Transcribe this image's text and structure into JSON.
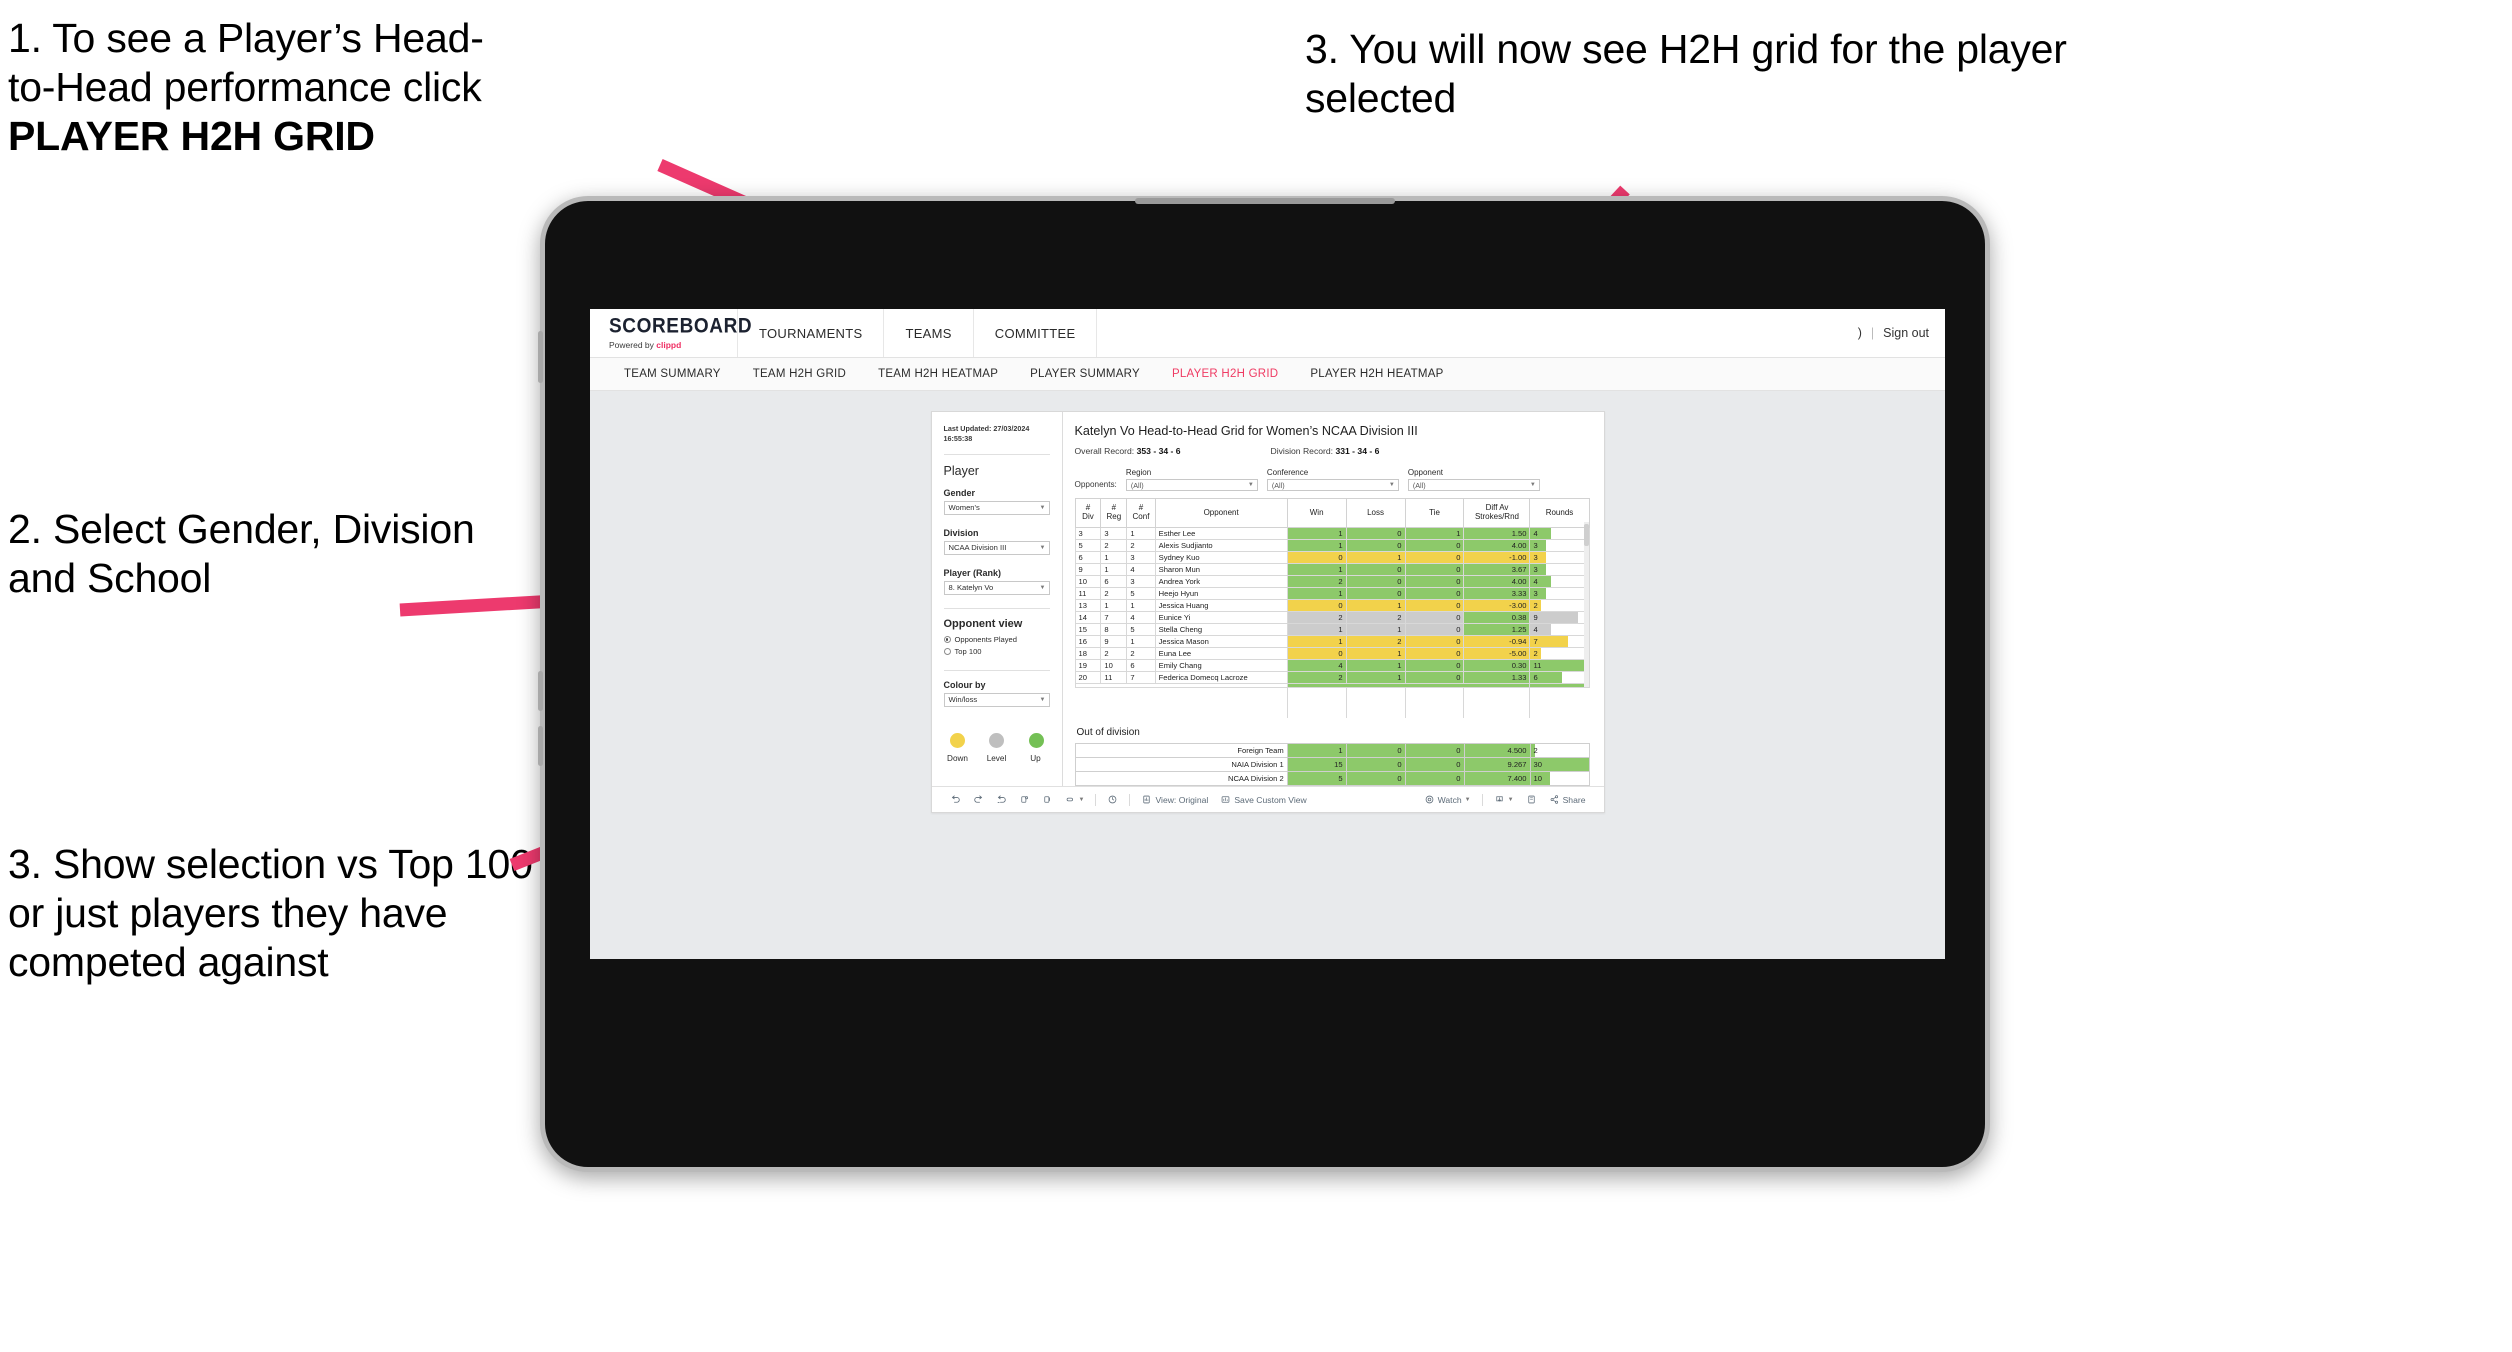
{
  "annotations": {
    "a1_line1": "1. To see a Player’s Head-",
    "a1_line2": "to-Head performance click",
    "a1_bold": "PLAYER H2H GRID",
    "a2": "2. Select Gender, Division and School",
    "a3": "3. Show selection vs Top 100 or just players they have competed against",
    "a4": "3. You will now see H2H grid for the player selected",
    "arrow_color": "#ed3a6e"
  },
  "app": {
    "logo_word": "SCOREBOARD",
    "logo_sub_pre": "Powered by ",
    "logo_sub_brand": "clippd",
    "top_nav": [
      "TOURNAMENTS",
      "TEAMS",
      "COMMITTEE"
    ],
    "account_glyph": ")",
    "sign_out": "Sign out",
    "sub_nav": [
      {
        "label": "TEAM SUMMARY",
        "active": false
      },
      {
        "label": "TEAM H2H GRID",
        "active": false
      },
      {
        "label": "TEAM H2H HEATMAP",
        "active": false
      },
      {
        "label": "PLAYER SUMMARY",
        "active": false
      },
      {
        "label": "PLAYER H2H GRID",
        "active": true
      },
      {
        "label": "PLAYER H2H HEATMAP",
        "active": false
      }
    ],
    "active_color": "#ef3b63"
  },
  "panel": {
    "last_updated_line1": "Last Updated: 27/03/2024",
    "last_updated_line2": "16:55:38",
    "heading": "Player",
    "fields": [
      {
        "label": "Gender",
        "value": "Women's"
      },
      {
        "label": "Division",
        "value": "NCAA Division III"
      },
      {
        "label": "Player (Rank)",
        "value": "8. Katelyn Vo"
      }
    ],
    "opponent_view": {
      "heading": "Opponent view",
      "options": [
        {
          "label": "Opponents Played",
          "selected": true
        },
        {
          "label": "Top 100",
          "selected": false
        }
      ]
    },
    "colour_by": {
      "label": "Colour by",
      "value": "Win/loss"
    },
    "legend": [
      {
        "label": "Down",
        "color": "#f2d24b"
      },
      {
        "label": "Level",
        "color": "#bfbfbf"
      },
      {
        "label": "Up",
        "color": "#74c055"
      }
    ]
  },
  "main": {
    "title": "Katelyn Vo Head-to-Head Grid for Women’s NCAA Division III",
    "overall_record_label": "Overall Record: ",
    "overall_record_value": "353 -  34 - 6",
    "division_record_label": "Division Record: ",
    "division_record_value": "331 -  34 - 6",
    "opponents_label": "Opponents:",
    "opponent_filters": [
      {
        "label": "Region",
        "value": "(All)"
      },
      {
        "label": "Conference",
        "value": "(All)"
      },
      {
        "label": "Opponent",
        "value": "(All)"
      }
    ]
  },
  "chart_data": {
    "type": "table",
    "title": "Katelyn Vo Head-to-Head Grid for Women’s NCAA Division III",
    "columns": [
      "# Div",
      "# Reg",
      "# Conf",
      "Opponent",
      "Win",
      "Loss",
      "Tie",
      "Diff Av Strokes/Rnd",
      "Rounds"
    ],
    "column_header_lines": [
      [
        "#",
        "Div"
      ],
      [
        "#",
        "Reg"
      ],
      [
        "#",
        "Conf"
      ],
      [
        "Opponent"
      ],
      [
        "Win"
      ],
      [
        "Loss"
      ],
      [
        "Tie"
      ],
      [
        "Diff Av",
        "Strokes/Rnd"
      ],
      [
        "Rounds"
      ]
    ],
    "rows_max_rounds": 11,
    "rows": [
      {
        "div": "3",
        "reg": "3",
        "conf": "1",
        "opponent": "Esther Lee",
        "win": "1",
        "loss": "0",
        "tie": "1",
        "diff": "1.50",
        "rounds": 4,
        "color": "#8dc96a"
      },
      {
        "div": "5",
        "reg": "2",
        "conf": "2",
        "opponent": "Alexis Sudjianto",
        "win": "1",
        "loss": "0",
        "tie": "0",
        "diff": "4.00",
        "rounds": 3,
        "color": "#8dc96a"
      },
      {
        "div": "6",
        "reg": "1",
        "conf": "3",
        "opponent": "Sydney Kuo",
        "win": "0",
        "loss": "1",
        "tie": "0",
        "diff": "-1.00",
        "rounds": 3,
        "color": "#f2d24b"
      },
      {
        "div": "9",
        "reg": "1",
        "conf": "4",
        "opponent": "Sharon Mun",
        "win": "1",
        "loss": "0",
        "tie": "0",
        "diff": "3.67",
        "rounds": 3,
        "color": "#8dc96a"
      },
      {
        "div": "10",
        "reg": "6",
        "conf": "3",
        "opponent": "Andrea York",
        "win": "2",
        "loss": "0",
        "tie": "0",
        "diff": "4.00",
        "rounds": 4,
        "color": "#8dc96a"
      },
      {
        "div": "11",
        "reg": "2",
        "conf": "5",
        "opponent": "Heejo Hyun",
        "win": "1",
        "loss": "0",
        "tie": "0",
        "diff": "3.33",
        "rounds": 3,
        "color": "#8dc96a"
      },
      {
        "div": "13",
        "reg": "1",
        "conf": "1",
        "opponent": "Jessica Huang",
        "win": "0",
        "loss": "1",
        "tie": "0",
        "diff": "-3.00",
        "rounds": 2,
        "color": "#f2d24b"
      },
      {
        "div": "14",
        "reg": "7",
        "conf": "4",
        "opponent": "Eunice Yi",
        "win": "2",
        "loss": "2",
        "tie": "0",
        "diff": "0.38",
        "rounds": 9,
        "color": "#cccccc",
        "diff_color": "#8dc96a"
      },
      {
        "div": "15",
        "reg": "8",
        "conf": "5",
        "opponent": "Stella Cheng",
        "win": "1",
        "loss": "1",
        "tie": "0",
        "diff": "1.25",
        "rounds": 4,
        "color": "#cccccc",
        "diff_color": "#8dc96a"
      },
      {
        "div": "16",
        "reg": "9",
        "conf": "1",
        "opponent": "Jessica Mason",
        "win": "1",
        "loss": "2",
        "tie": "0",
        "diff": "-0.94",
        "rounds": 7,
        "color": "#f2d24b"
      },
      {
        "div": "18",
        "reg": "2",
        "conf": "2",
        "opponent": "Euna Lee",
        "win": "0",
        "loss": "1",
        "tie": "0",
        "diff": "-5.00",
        "rounds": 2,
        "color": "#f2d24b"
      },
      {
        "div": "19",
        "reg": "10",
        "conf": "6",
        "opponent": "Emily Chang",
        "win": "4",
        "loss": "1",
        "tie": "0",
        "diff": "0.30",
        "rounds": 11,
        "color": "#8dc96a"
      },
      {
        "div": "20",
        "reg": "11",
        "conf": "7",
        "opponent": "Federica Domecq Lacroze",
        "win": "2",
        "loss": "1",
        "tie": "0",
        "diff": "1.33",
        "rounds": 6,
        "color": "#8dc96a"
      }
    ],
    "out_of_division": {
      "heading": "Out of division",
      "max_rounds": 30,
      "rows": [
        {
          "name": "Foreign Team",
          "win": "1",
          "loss": "0",
          "tie": "0",
          "diff": "4.500",
          "rounds": 2,
          "color": "#8dc96a"
        },
        {
          "name": "NAIA Division 1",
          "win": "15",
          "loss": "0",
          "tie": "0",
          "diff": "9.267",
          "rounds": 30,
          "color": "#8dc96a"
        },
        {
          "name": "NCAA Division 2",
          "win": "5",
          "loss": "0",
          "tie": "0",
          "diff": "7.400",
          "rounds": 10,
          "color": "#8dc96a"
        }
      ]
    }
  },
  "toolbar": {
    "view_label": "View: Original",
    "save_label": "Save Custom View",
    "watch_label": "Watch",
    "share_label": "Share"
  }
}
